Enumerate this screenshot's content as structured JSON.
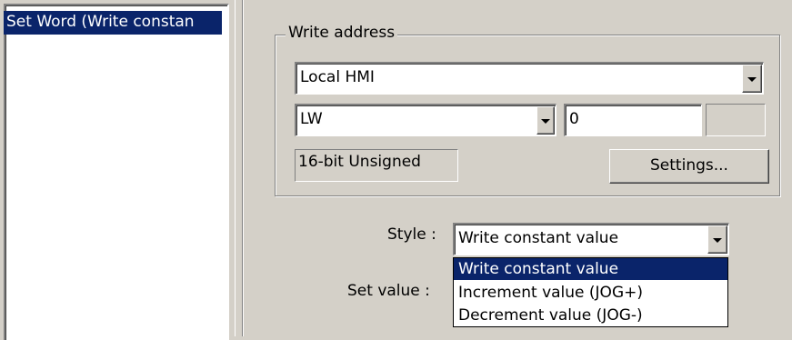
{
  "actions_list": {
    "items": [
      {
        "label": "Set Word (Write constan",
        "selected": true
      }
    ]
  },
  "write_address": {
    "group_title": "Write address",
    "device": {
      "value": "Local HMI"
    },
    "address_type": {
      "value": "LW"
    },
    "address": {
      "value": "0"
    },
    "data_format": {
      "value": "16-bit Unsigned"
    },
    "settings_button": {
      "label": "Settings..."
    }
  },
  "style": {
    "label": "Style :",
    "value": "Write constant value",
    "options": [
      "Write constant value",
      "Increment value (JOG+)",
      "Decrement value (JOG-)"
    ],
    "highlighted_index": 0
  },
  "set_value": {
    "label": "Set value :"
  },
  "colors": {
    "highlight": "#0a246a",
    "face": "#d4d0c8"
  },
  "icons": {
    "dropdown_arrow": "chevron-down-icon"
  }
}
